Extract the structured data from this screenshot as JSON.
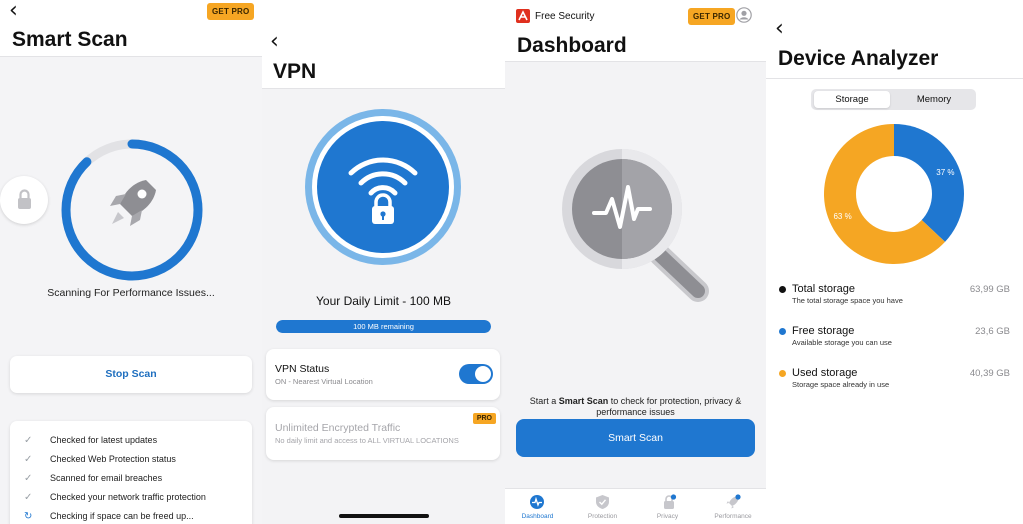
{
  "smart_scan": {
    "title": "Smart Scan",
    "get_pro": "GET PRO",
    "status": "Scanning For Performance Issues...",
    "progress": 0.88,
    "stop_button": "Stop Scan",
    "checks": [
      "Checked for latest updates",
      "Checked Web Protection status",
      "Scanned for email breaches",
      "Checked your network traffic protection",
      "Checking if space can be freed up..."
    ]
  },
  "vpn": {
    "title": "VPN",
    "daily_limit": "Your Daily Limit - 100 MB",
    "remaining": "100 MB remaining",
    "remaining_fraction": 1.0,
    "status_title": "VPN Status",
    "status_sub": "ON - Nearest Virtual Location",
    "toggle_on": true,
    "unlimited_title": "Unlimited Encrypted Traffic",
    "unlimited_sub": "No daily limit and access to ALL VIRTUAL LOCATIONS",
    "pro_badge": "PRO"
  },
  "dashboard": {
    "app_name": "Free Security",
    "get_pro": "GET PRO",
    "title": "Dashboard",
    "description_pre": "Start a ",
    "description_bold": "Smart Scan",
    "description_post": " to check for protection, privacy & performance issues",
    "scan_button": "Smart Scan",
    "tabs": [
      {
        "label": "Dashboard",
        "icon": "pulse-icon",
        "active": true,
        "dot": false
      },
      {
        "label": "Protection",
        "icon": "shield-icon",
        "active": false,
        "dot": false
      },
      {
        "label": "Privacy",
        "icon": "lock-icon",
        "active": false,
        "dot": true
      },
      {
        "label": "Performance",
        "icon": "rocket-icon",
        "active": false,
        "dot": true
      }
    ]
  },
  "device_analyzer": {
    "title": "Device Analyzer",
    "segments": [
      "Storage",
      "Memory"
    ],
    "selected_segment": "Storage",
    "chart_data": {
      "type": "pie",
      "categories": [
        "Free storage",
        "Used storage"
      ],
      "values": [
        37,
        63
      ],
      "labels": [
        "37 %",
        "63 %"
      ],
      "colors": [
        "#1f77d0",
        "#f5a623"
      ]
    },
    "items": [
      {
        "name": "Total storage",
        "sub": "The total storage space you have",
        "value": "63,99 GB",
        "color": "#111111"
      },
      {
        "name": "Free storage",
        "sub": "Available storage you can use",
        "value": "23,6 GB",
        "color": "#1f77d0"
      },
      {
        "name": "Used storage",
        "sub": "Storage space already in use",
        "value": "40,39 GB",
        "color": "#f5a623"
      }
    ]
  },
  "colors": {
    "accent_blue": "#1f77d0",
    "pro_orange": "#f6a623",
    "brand_red": "#e0301e"
  }
}
